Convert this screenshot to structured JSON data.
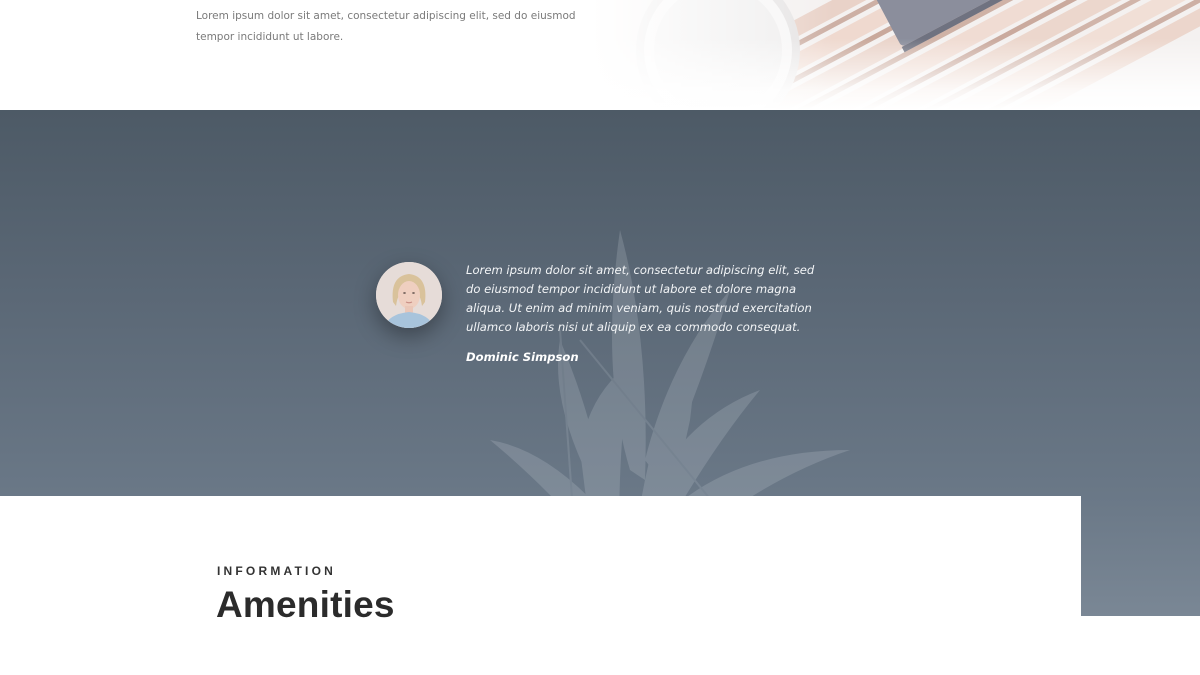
{
  "intro": {
    "text": "Lorem ipsum dolor sit amet, consectetur adipiscing elit, sed do eiusmod tempor incididunt ut labore.",
    "image_icon": "coffee-cup-bamboo-image"
  },
  "testimonial": {
    "quote": "Lorem ipsum dolor sit amet, consectetur adipiscing elit, sed do eiusmod tempor incididunt ut labore et dolore magna aliqua. Ut enim ad minim veniam, quis nostrud exercitation ullamco laboris nisi ut aliquip ex ea commodo consequat.",
    "author": "Dominic Simpson",
    "avatar_icon": "person-avatar",
    "background_icon": "plant-image",
    "colors": {
      "band_top": "#4d5a66",
      "band_bottom": "#6a7887",
      "text": "#f2f4f6"
    }
  },
  "amenities": {
    "eyebrow": "INFORMATION",
    "title": "Amenities"
  }
}
